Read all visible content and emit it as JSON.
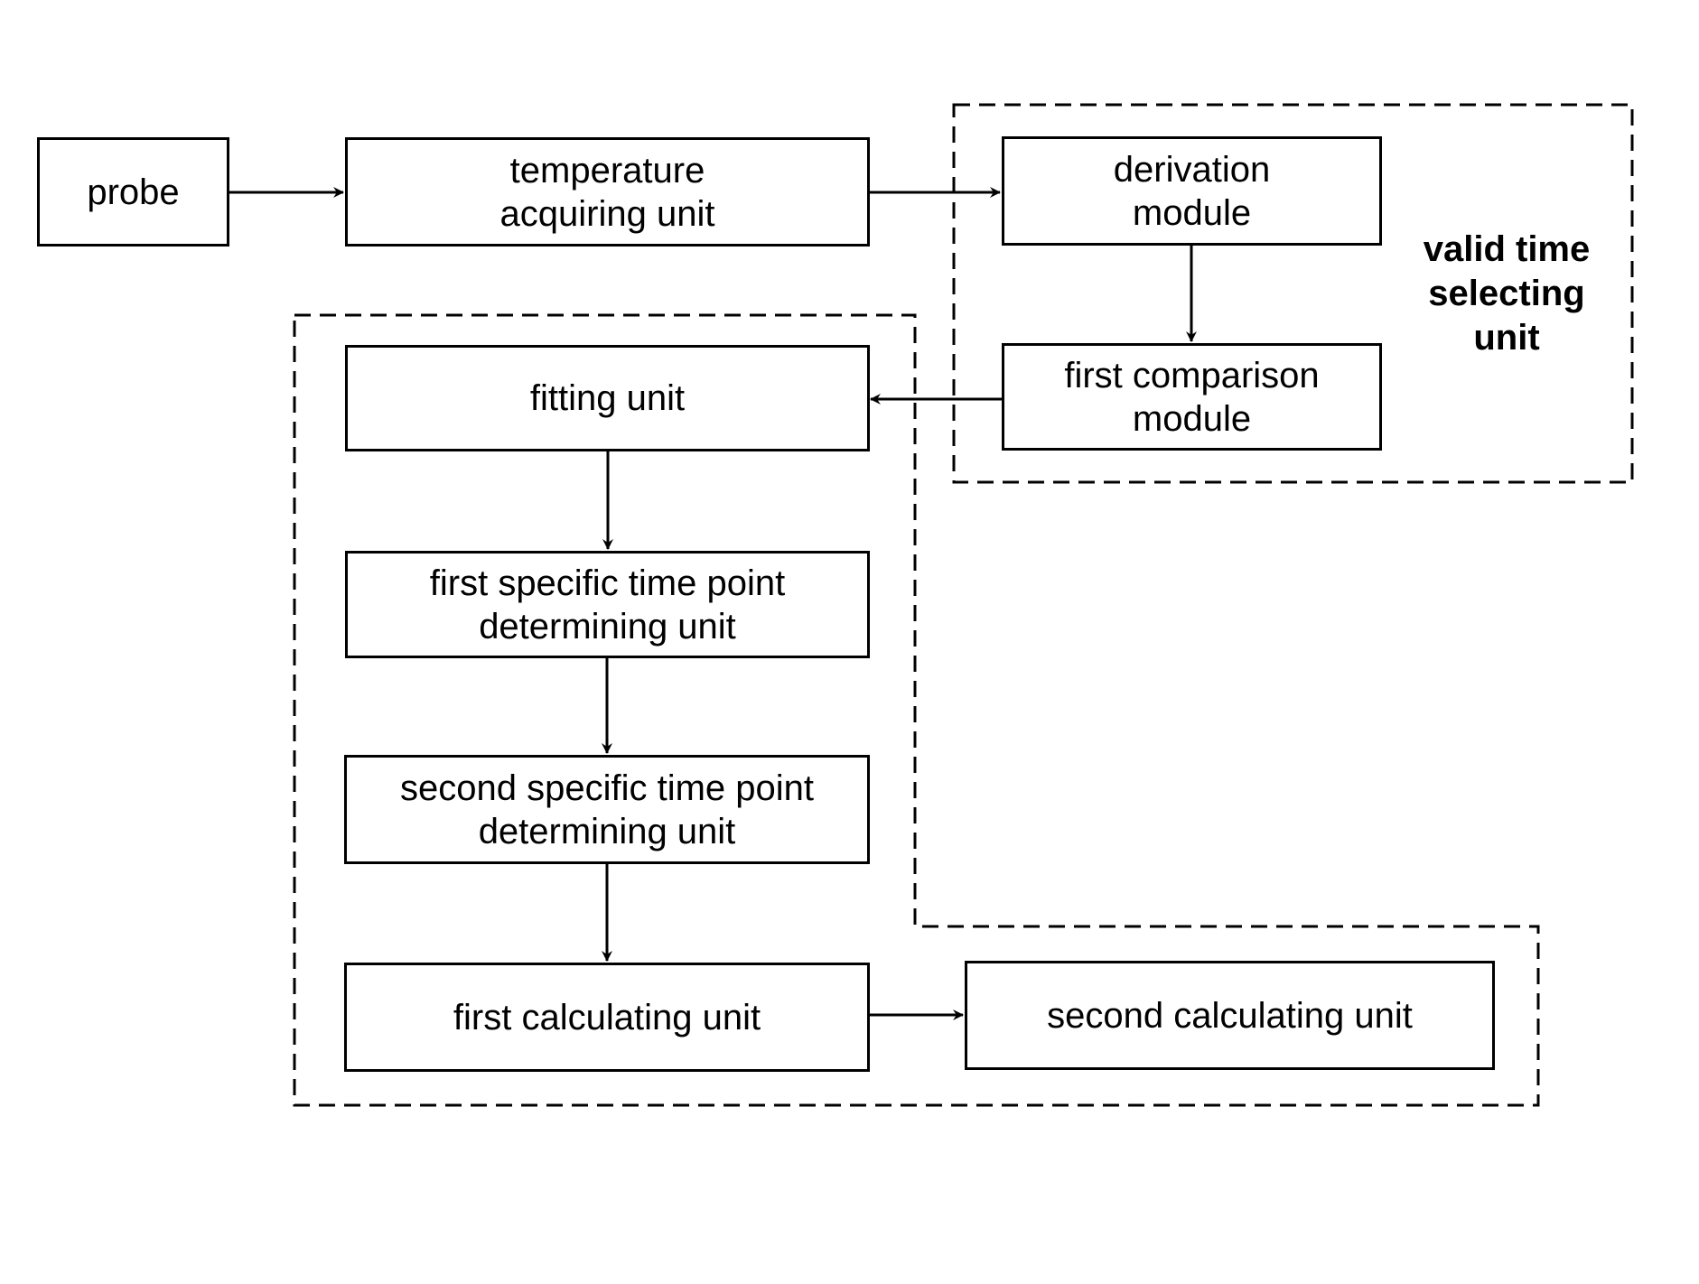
{
  "diagram": {
    "nodes": [
      {
        "id": "probe",
        "label": "probe"
      },
      {
        "id": "temperature_acquiring_unit",
        "label": "temperature\nacquiring unit"
      },
      {
        "id": "derivation_module",
        "label": "derivation\nmodule"
      },
      {
        "id": "first_comparison_module",
        "label": "first comparison\nmodule"
      },
      {
        "id": "fitting_unit",
        "label": "fitting unit"
      },
      {
        "id": "first_specific_time_point_determining_unit",
        "label": "first specific time point\ndetermining unit"
      },
      {
        "id": "second_specific_time_point_determining_unit",
        "label": "second specific time point\ndetermining unit"
      },
      {
        "id": "first_calculating_unit",
        "label": "first calculating unit"
      },
      {
        "id": "second_calculating_unit",
        "label": "second calculating unit"
      }
    ],
    "groups": [
      {
        "id": "valid_time_selecting_unit",
        "label": "valid time\nselecting\nunit",
        "members": [
          "derivation_module",
          "first_comparison_module"
        ]
      },
      {
        "id": "processing_group",
        "label": "",
        "members": [
          "fitting_unit",
          "first_specific_time_point_determining_unit",
          "second_specific_time_point_determining_unit",
          "first_calculating_unit",
          "second_calculating_unit"
        ]
      }
    ],
    "edges": [
      {
        "from": "probe",
        "to": "temperature_acquiring_unit"
      },
      {
        "from": "temperature_acquiring_unit",
        "to": "derivation_module"
      },
      {
        "from": "derivation_module",
        "to": "first_comparison_module"
      },
      {
        "from": "first_comparison_module",
        "to": "fitting_unit"
      },
      {
        "from": "fitting_unit",
        "to": "first_specific_time_point_determining_unit"
      },
      {
        "from": "first_specific_time_point_determining_unit",
        "to": "second_specific_time_point_determining_unit"
      },
      {
        "from": "second_specific_time_point_determining_unit",
        "to": "first_calculating_unit"
      },
      {
        "from": "first_calculating_unit",
        "to": "second_calculating_unit"
      }
    ]
  }
}
